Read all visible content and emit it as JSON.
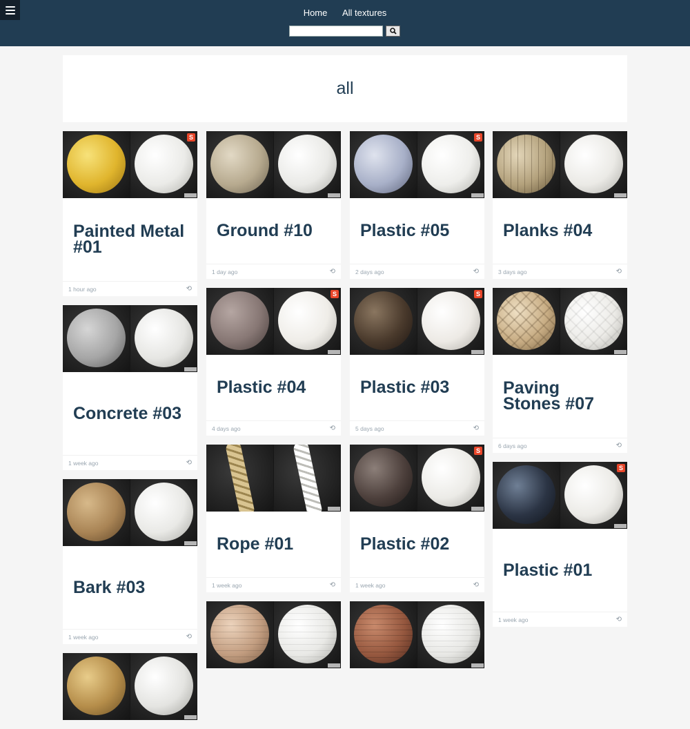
{
  "nav": {
    "home": "Home",
    "all_textures": "All textures",
    "search_placeholder": ""
  },
  "page_title": "all",
  "icons": {
    "menu": "hamburger-menu-icon",
    "search": "magnifier-icon",
    "badge": "substance-badge-icon",
    "refresh": "refresh-icon"
  },
  "columns": [
    [
      {
        "title": "Painted Metal #01",
        "time": "1 hour ago"
      },
      {
        "title": "Concrete #03",
        "time": "1 week ago"
      },
      {
        "title": "Bark #03",
        "time": "1 week ago"
      },
      {
        "title": "",
        "time": ""
      }
    ],
    [
      {
        "title": "Ground #10",
        "time": "1 day ago"
      },
      {
        "title": "Plastic #04",
        "time": "4 days ago"
      },
      {
        "title": "Rope #01",
        "time": "1 week ago"
      },
      {
        "title": "",
        "time": ""
      }
    ],
    [
      {
        "title": "Plastic #05",
        "time": "2 days ago"
      },
      {
        "title": "Plastic #03",
        "time": "5 days ago"
      },
      {
        "title": "Plastic #02",
        "time": "1 week ago"
      },
      {
        "title": "",
        "time": ""
      }
    ],
    [
      {
        "title": "Planks #04",
        "time": "3 days ago"
      },
      {
        "title": "Paving Stones #07",
        "time": "6 days ago"
      },
      {
        "title": "Plastic #01",
        "time": "1 week ago"
      }
    ]
  ]
}
